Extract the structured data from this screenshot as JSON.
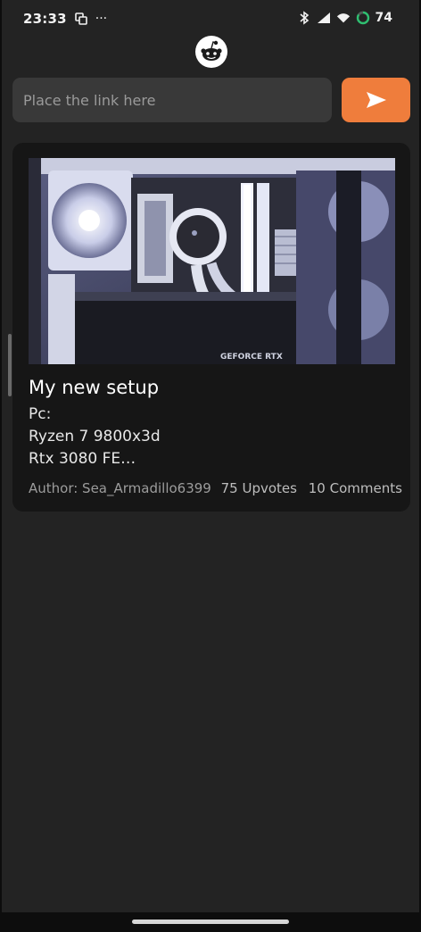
{
  "status_bar": {
    "time": "23:33",
    "overflow": "···",
    "battery_level": "74",
    "icons": [
      "screen-record-icon",
      "bluetooth-icon",
      "signal-icon",
      "wifi-icon",
      "battery-ring-icon"
    ]
  },
  "app": {
    "logo_icon": "reddit-alien-icon"
  },
  "link_input": {
    "placeholder": "Place the link here",
    "value": ""
  },
  "send_button": {
    "icon": "send-arrow-icon",
    "color": "#ef7d3c"
  },
  "post": {
    "title": "My new setup",
    "body_lines": [
      "Pc:",
      "Ryzen 7 9800x3d",
      "Rtx 3080 FE…"
    ],
    "author": "Author: Sea_Armadillo6399",
    "upvotes": "75 Upvotes",
    "comments": "10 Comments",
    "image_label": "GEFORCE RTX"
  },
  "colors": {
    "background": "#232323",
    "card": "#161616",
    "input": "#393939",
    "accent": "#ef7d3c"
  }
}
